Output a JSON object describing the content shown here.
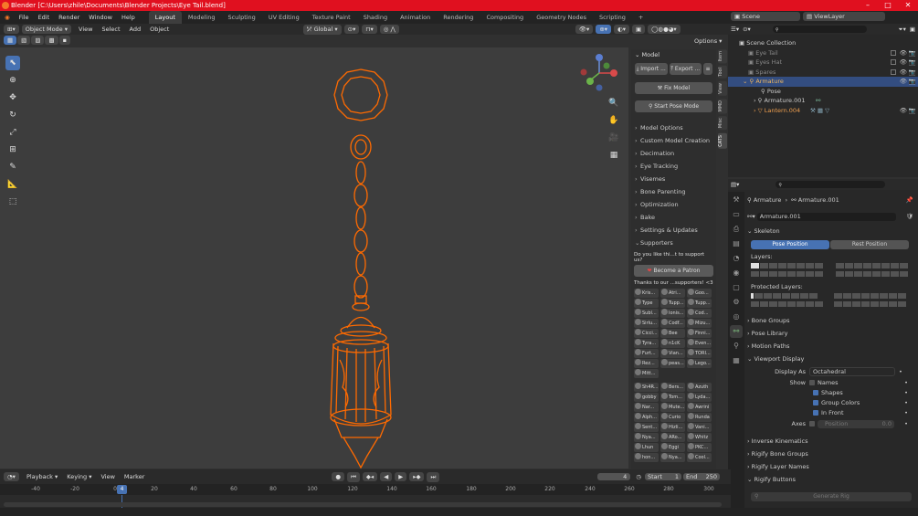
{
  "window": {
    "title": "Blender [C:\\Users\\zhile\\Documents\\Blender Projects\\Eye Tail.blend]",
    "controls": [
      "–",
      "□",
      "✕"
    ]
  },
  "menu": [
    "File",
    "Edit",
    "Render",
    "Window",
    "Help"
  ],
  "workspaces": [
    "Layout",
    "Modeling",
    "Sculpting",
    "UV Editing",
    "Texture Paint",
    "Shading",
    "Animation",
    "Rendering",
    "Compositing",
    "Geometry Nodes",
    "Scripting",
    "+"
  ],
  "workspace_active": 0,
  "scene": {
    "label": "Scene",
    "view_layer": "ViewLayer"
  },
  "viewport_header": {
    "mode": "Object Mode",
    "menus": [
      "View",
      "Select",
      "Add",
      "Object"
    ],
    "orientation": "Global",
    "options": "Options"
  },
  "npanel": {
    "model_header": "Model",
    "import_btn": "Import ...",
    "export_btn": "Export ...",
    "fix_model": "Fix Model",
    "start_pose": "Start Pose Mode",
    "sections": [
      "Model Options",
      "Custom Model Creation",
      "Decimation",
      "Eye Tracking",
      "Visemes",
      "Bone Parenting",
      "Optimization",
      "Bake",
      "Settings & Updates"
    ],
    "supporters_header": "Supporters",
    "support_text": "Do you like thi...t to support us?",
    "patron_btn": "Become a Patron",
    "thanks": "Thanks to our ...supporters! <3",
    "supporters_a": [
      "Kris...",
      "Atri...",
      "Goo...",
      "Type",
      "Tupp...",
      "Tupp...",
      "Subl...",
      "Ionis...",
      "Cod...",
      "Sirlu...",
      "Codf...",
      "Mizu...",
      "Cicci...",
      "Bee",
      "Finni...",
      "Tyra...",
      "n1cK",
      "Even...",
      "Furt...",
      "Vian...",
      "TORI...",
      "Rez...",
      "peas...",
      "Lego...",
      "Mitt..."
    ],
    "supporters_b": [
      "Sh4R...",
      "Bers...",
      "Azuth",
      "gobby",
      "Tom...",
      "Lyda...",
      "Nar...",
      "Mute...",
      "Awrini",
      "Alph...",
      "Curio",
      "Runda",
      "Sent...",
      "Hizli...",
      "Vani...",
      "Nya...",
      "ARo...",
      "Whitz",
      "Lhun",
      "Eggi",
      "PKC...",
      "hon...",
      "Nya...",
      "Cool..."
    ]
  },
  "side_tabs": [
    "Item",
    "Tool",
    "View",
    "MMD",
    "Misc",
    "CATS"
  ],
  "outliner": {
    "rows": [
      {
        "label": "Scene Collection",
        "indent": 0
      },
      {
        "label": "Eye Tail",
        "indent": 1
      },
      {
        "label": "Eyes Hat",
        "indent": 1
      },
      {
        "label": "Spares",
        "indent": 1
      },
      {
        "label": "Armature",
        "indent": 1
      },
      {
        "label": "Pose",
        "indent": 2
      },
      {
        "label": "Armature.001",
        "indent": 2
      },
      {
        "label": "Lantern.004",
        "indent": 2
      }
    ]
  },
  "properties": {
    "breadcrumb_a": "Armature",
    "breadcrumb_b": "Armature.001",
    "name": "Armature.001",
    "skeleton": "Skeleton",
    "pose_position": "Pose Position",
    "rest_position": "Rest Position",
    "layers": "Layers:",
    "protected_layers": "Protected Layers:",
    "bone_groups": "Bone Groups",
    "pose_library": "Pose Library",
    "motion_paths": "Motion Paths",
    "viewport_display": "Viewport Display",
    "display_as_label": "Display As",
    "display_as": "Octahedral",
    "show_label": "Show",
    "names": "Names",
    "shapes": "Shapes",
    "group_colors": "Group Colors",
    "in_front": "In Front",
    "axes": "Axes",
    "position": "Position",
    "position_value": "0.0",
    "ik": "Inverse Kinematics",
    "rigify_bone_groups": "Rigify Bone Groups",
    "rigify_layer_names": "Rigify Layer Names",
    "rigify_buttons": "Rigify Buttons",
    "generate_rig": "Generate Rig"
  },
  "timeline": {
    "menus": [
      "Playback",
      "Keying",
      "View",
      "Marker"
    ],
    "current_frame": "4",
    "start_label": "Start",
    "start": "1",
    "end_label": "End",
    "end": "250",
    "ticks": [
      "-40",
      "-20",
      "0",
      "20",
      "40",
      "60",
      "80",
      "100",
      "120",
      "140",
      "160",
      "180",
      "200",
      "220",
      "240",
      "260",
      "280",
      "300"
    ]
  },
  "colors": {
    "accent": "#4772b3",
    "wire": "#ff6a00",
    "titlebar": "#e0101f"
  }
}
